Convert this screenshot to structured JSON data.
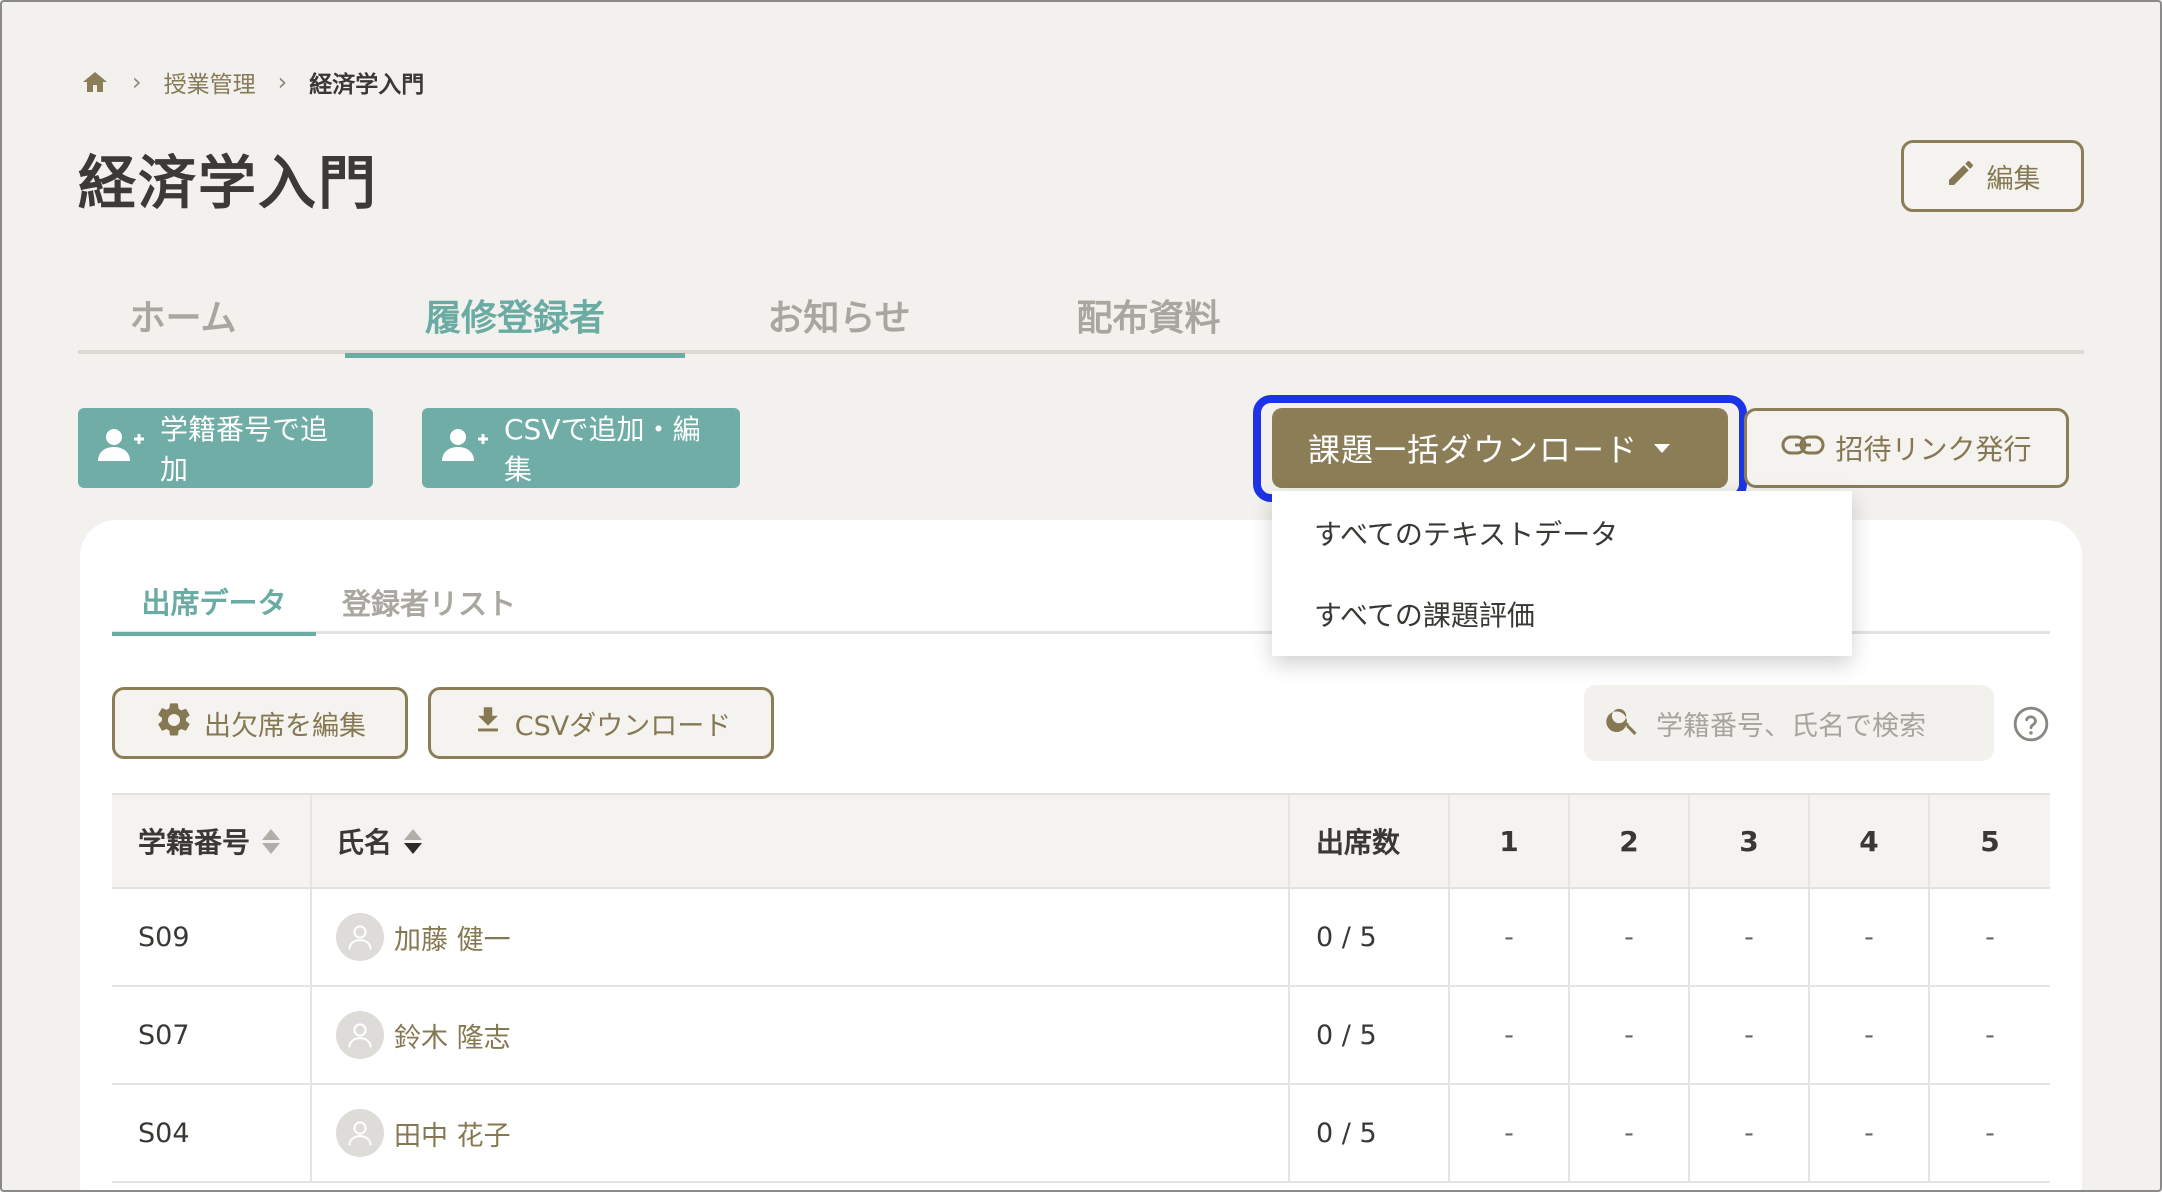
{
  "breadcrumb": {
    "home_icon": "home-icon",
    "course_management": "授業管理",
    "current": "経済学入門"
  },
  "page_title": "経済学入門",
  "edit_button": {
    "label": "編集",
    "icon": "pencil-icon"
  },
  "main_tabs": [
    {
      "label": "ホーム",
      "active": false
    },
    {
      "label": "履修登録者",
      "active": true
    },
    {
      "label": "お知らせ",
      "active": false
    },
    {
      "label": "配布資料",
      "active": false
    }
  ],
  "actions": {
    "add_by_id": "学籍番号で追加",
    "add_by_csv": "CSVで追加・編集",
    "bulk_download": "課題一括ダウンロード",
    "invite_link": "招待リンク発行"
  },
  "dropdown": {
    "items": [
      "すべてのテキストデータ",
      "すべての課題評価"
    ]
  },
  "sub_tabs": [
    {
      "label": "出席データ",
      "active": true
    },
    {
      "label": "登録者リスト",
      "active": false
    }
  ],
  "toolbar": {
    "edit_attendance": "出欠席を編集",
    "csv_download": "CSVダウンロード",
    "search_placeholder": "学籍番号、氏名で検索"
  },
  "table": {
    "headers": {
      "student_id": "学籍番号",
      "name": "氏名",
      "attendance": "出席数",
      "sessions": [
        "1",
        "2",
        "3",
        "4",
        "5"
      ]
    },
    "rows": [
      {
        "id": "S09",
        "name": "加藤 健一",
        "attendance": "0 / 5",
        "sessions": [
          "-",
          "-",
          "-",
          "-",
          "-"
        ]
      },
      {
        "id": "S07",
        "name": "鈴木 隆志",
        "attendance": "0 / 5",
        "sessions": [
          "-",
          "-",
          "-",
          "-",
          "-"
        ]
      },
      {
        "id": "S04",
        "name": "田中 花子",
        "attendance": "0 / 5",
        "sessions": [
          "-",
          "-",
          "-",
          "-",
          "-"
        ]
      }
    ]
  },
  "colors": {
    "teal": "#6fada6",
    "brown": "#8b7d56",
    "focus": "#1d33e6",
    "background": "#f3f1ed"
  }
}
